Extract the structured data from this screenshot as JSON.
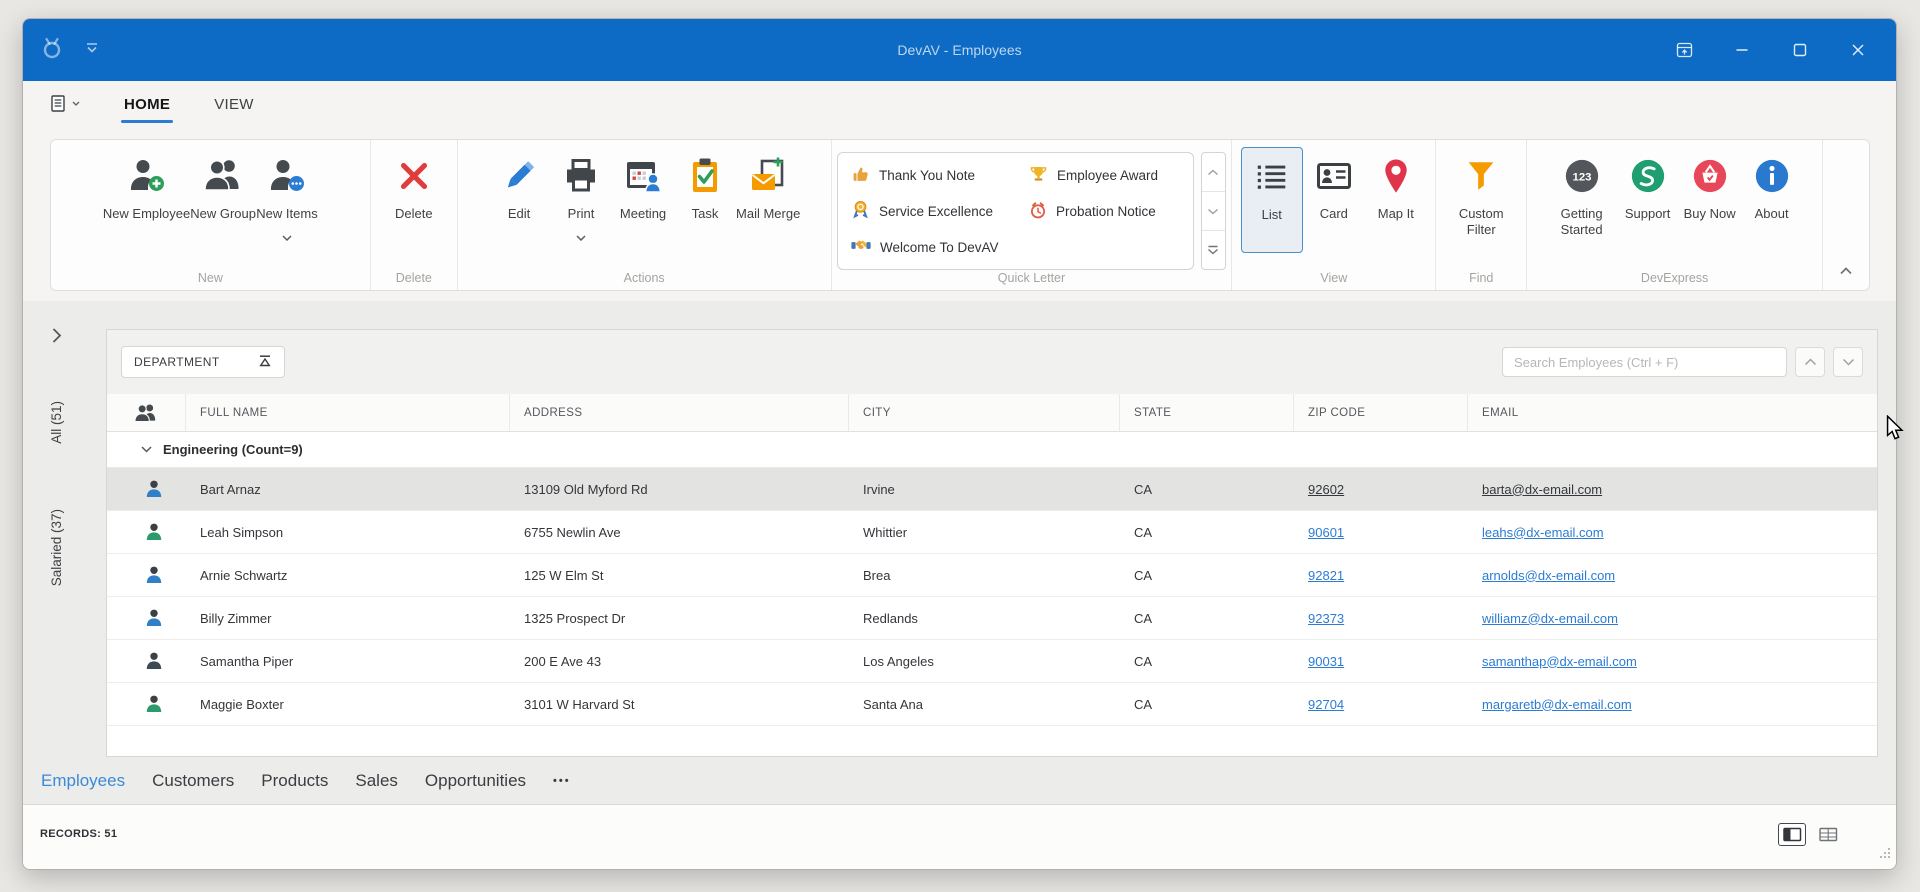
{
  "window": {
    "title": "DevAV - Employees"
  },
  "ribbon": {
    "tabs": [
      {
        "label": "HOME",
        "active": true
      },
      {
        "label": "VIEW",
        "active": false
      }
    ],
    "groups": [
      {
        "caption": "New",
        "buttons": [
          {
            "label": "New Employee",
            "icon": "person-add-icon"
          },
          {
            "label": "New Group",
            "icon": "people-icon"
          },
          {
            "label": "New Items",
            "icon": "person-more-icon",
            "dropdown": true
          }
        ]
      },
      {
        "caption": "Delete",
        "buttons": [
          {
            "label": "Delete",
            "icon": "delete-x-icon"
          }
        ]
      },
      {
        "caption": "Actions",
        "buttons": [
          {
            "label": "Edit",
            "icon": "pencil-icon"
          },
          {
            "label": "Print",
            "icon": "printer-icon",
            "dropdown": true
          },
          {
            "label": "Meeting",
            "icon": "calendar-person-icon"
          },
          {
            "label": "Task",
            "icon": "task-check-icon"
          },
          {
            "label": "Mail Merge",
            "icon": "mail-add-icon"
          }
        ]
      },
      {
        "caption": "Quick Letter",
        "gallery": {
          "column1": [
            {
              "label": "Thank You Note",
              "icon": "thumbs-up-icon"
            },
            {
              "label": "Service Excellence",
              "icon": "medal-icon"
            },
            {
              "label": "Welcome To DevAV",
              "icon": "handshake-icon"
            }
          ],
          "column2": [
            {
              "label": "Employee Award",
              "icon": "trophy-icon"
            },
            {
              "label": "Probation Notice",
              "icon": "alarm-clock-icon"
            }
          ]
        }
      },
      {
        "caption": "View",
        "buttons": [
          {
            "label": "List",
            "icon": "list-view-icon",
            "selected": true
          },
          {
            "label": "Card",
            "icon": "card-view-icon"
          },
          {
            "label": "Map It",
            "icon": "map-pin-icon"
          }
        ]
      },
      {
        "caption": "Find",
        "buttons": [
          {
            "label": "Custom Filter",
            "icon": "filter-funnel-icon"
          }
        ]
      },
      {
        "caption": "DevExpress",
        "buttons": [
          {
            "label": "Getting Started",
            "icon": "badge-123-icon"
          },
          {
            "label": "Support",
            "icon": "support-circle-icon"
          },
          {
            "label": "Buy Now",
            "icon": "buy-basket-icon"
          },
          {
            "label": "About",
            "icon": "info-circle-icon"
          }
        ]
      }
    ]
  },
  "sidebar": {
    "items": [
      {
        "label": "All (51)"
      },
      {
        "label": "Salaried (37)"
      }
    ]
  },
  "grid": {
    "filter_chip": {
      "label": "DEPARTMENT",
      "icon": "sort-icon"
    },
    "search": {
      "placeholder": "Search Employees (Ctrl + F)"
    },
    "columns": [
      "FULL NAME",
      "ADDRESS",
      "CITY",
      "STATE",
      "ZIP CODE",
      "EMAIL"
    ],
    "group_row": {
      "label": "Engineering (Count=9)"
    },
    "rows": [
      {
        "name": "Bart Arnaz",
        "address": "13109 Old Myford Rd",
        "city": "Irvine",
        "state": "CA",
        "zip": "92602",
        "email": "barta@dx-email.com",
        "selected": true,
        "avatar_color": "#2f80c7"
      },
      {
        "name": "Leah Simpson",
        "address": "6755 Newlin Ave",
        "city": "Whittier",
        "state": "CA",
        "zip": "90601",
        "email": "leahs@dx-email.com",
        "selected": false,
        "avatar_color": "#2d9a6b"
      },
      {
        "name": "Arnie Schwartz",
        "address": "125 W Elm St",
        "city": "Brea",
        "state": "CA",
        "zip": "92821",
        "email": "arnolds@dx-email.com",
        "selected": false,
        "avatar_color": "#2f80c7"
      },
      {
        "name": "Billy Zimmer",
        "address": "1325 Prospect Dr",
        "city": "Redlands",
        "state": "CA",
        "zip": "92373",
        "email": "williamz@dx-email.com",
        "selected": false,
        "avatar_color": "#2f80c7"
      },
      {
        "name": "Samantha Piper",
        "address": "200 E Ave 43",
        "city": "Los Angeles",
        "state": "CA",
        "zip": "90031",
        "email": "samanthap@dx-email.com",
        "selected": false,
        "avatar_color": "#3e4a52"
      },
      {
        "name": "Maggie Boxter",
        "address": "3101 W Harvard St",
        "city": "Santa Ana",
        "state": "CA",
        "zip": "92704",
        "email": "margaretb@dx-email.com",
        "selected": false,
        "avatar_color": "#2d9a6b"
      }
    ]
  },
  "bottom_nav": {
    "tabs": [
      {
        "label": "Employees",
        "active": true
      },
      {
        "label": "Customers",
        "active": false
      },
      {
        "label": "Products",
        "active": false
      },
      {
        "label": "Sales",
        "active": false
      },
      {
        "label": "Opportunities",
        "active": false
      }
    ],
    "more_label": "•••"
  },
  "status_bar": {
    "records_label": "RECORDS: 51"
  },
  "colors": {
    "titlebar": "#0d6bc5",
    "accent": "#2b7cd3",
    "link": "#2b7cd3",
    "selected_row": "#e3e3e2",
    "danger": "#e03c3c",
    "orange": "#f59b00",
    "green": "#2e9e5b"
  }
}
